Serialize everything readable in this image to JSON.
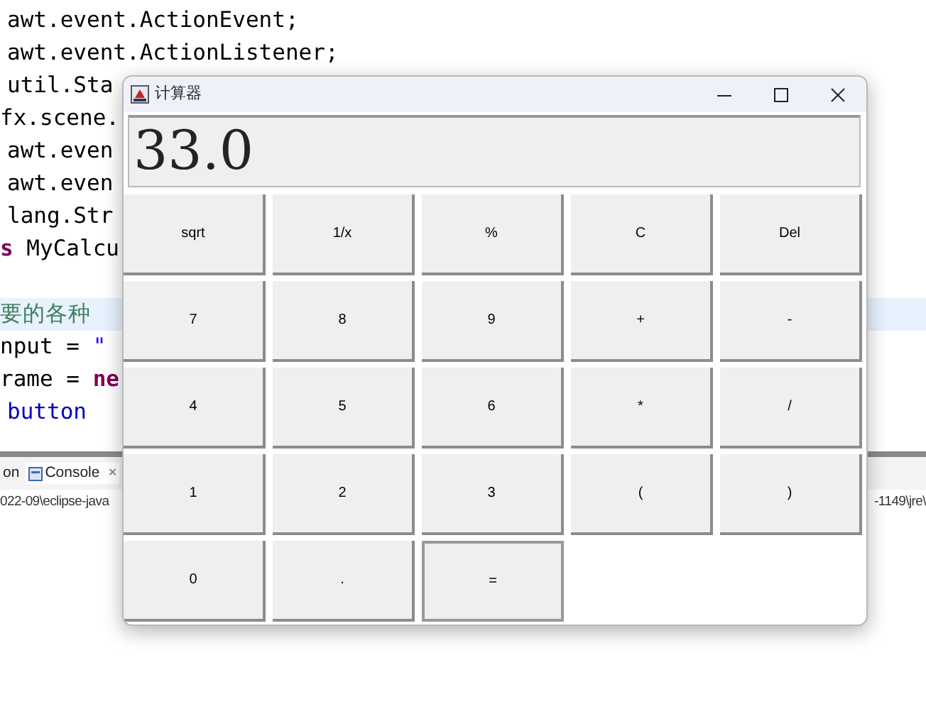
{
  "editor": {
    "lines": [
      {
        "highlighted": false,
        "segments": [
          {
            "text": "awt.event.ActionEvent;",
            "kind": "plain"
          }
        ]
      },
      {
        "highlighted": false,
        "segments": [
          {
            "text": "awt.event.ActionListener;",
            "kind": "plain"
          }
        ]
      },
      {
        "highlighted": false,
        "segments": [
          {
            "text": "util.Sta",
            "kind": "plain"
          }
        ]
      },
      {
        "highlighted": false,
        "segments": [
          {
            "text": "fx.scene.",
            "kind": "plain"
          }
        ]
      },
      {
        "highlighted": false,
        "segments": [
          {
            "text": "awt.even",
            "kind": "plain"
          }
        ]
      },
      {
        "highlighted": false,
        "segments": [
          {
            "text": "awt.even",
            "kind": "plain"
          }
        ]
      },
      {
        "highlighted": false,
        "segments": [
          {
            "text": "lang.Str",
            "kind": "plain"
          }
        ]
      },
      {
        "highlighted": false,
        "segments": [
          {
            "text": "s",
            "kind": "keyword"
          },
          {
            "text": " MyCalcu",
            "kind": "plain"
          }
        ]
      },
      {
        "highlighted": false
      },
      {
        "highlighted": true,
        "segments": [
          {
            "text": "要的各种",
            "kind": "comment"
          }
        ]
      },
      {
        "highlighted": false,
        "segments": [
          {
            "text": "nput = ",
            "kind": "plain"
          },
          {
            "text": "\"",
            "kind": "string"
          }
        ]
      },
      {
        "highlighted": false,
        "segments": [
          {
            "text": "rame = ",
            "kind": "plain"
          },
          {
            "text": "ne",
            "kind": "keyword"
          }
        ]
      },
      {
        "highlighted": false,
        "segments": [
          {
            "text": "button",
            "kind": "field"
          }
        ]
      }
    ]
  },
  "console": {
    "tabs": [
      {
        "label": "on",
        "selected": false
      },
      {
        "label": "Console",
        "selected": true,
        "close": "×"
      }
    ],
    "path_left": "022-09\\eclipse-java",
    "path_right": "-1149\\jre\\"
  },
  "calculator": {
    "title": "计算器",
    "display": "33.0",
    "buttons": [
      {
        "label": "sqrt",
        "focused": false
      },
      {
        "label": "1/x",
        "focused": false
      },
      {
        "label": "%",
        "focused": false
      },
      {
        "label": "C",
        "focused": false
      },
      {
        "label": "Del",
        "focused": false
      },
      {
        "label": "7",
        "focused": false
      },
      {
        "label": "8",
        "focused": false
      },
      {
        "label": "9",
        "focused": false
      },
      {
        "label": "+",
        "focused": false
      },
      {
        "label": "-",
        "focused": false
      },
      {
        "label": "4",
        "focused": false
      },
      {
        "label": "5",
        "focused": false
      },
      {
        "label": "6",
        "focused": false
      },
      {
        "label": "*",
        "focused": false
      },
      {
        "label": "/",
        "focused": false
      },
      {
        "label": "1",
        "focused": false
      },
      {
        "label": "2",
        "focused": false
      },
      {
        "label": "3",
        "focused": false
      },
      {
        "label": "(",
        "focused": false
      },
      {
        "label": ")",
        "focused": false
      },
      {
        "label": "0",
        "focused": false
      },
      {
        "label": ".",
        "focused": false
      },
      {
        "label": "=",
        "focused": true
      }
    ]
  }
}
